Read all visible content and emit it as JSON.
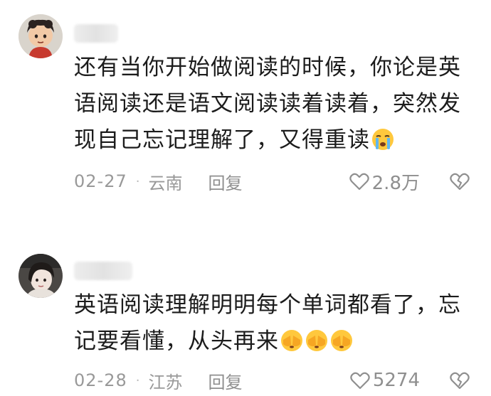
{
  "comments": [
    {
      "avatar_icon": "cartoon-character-avatar",
      "text": "还有当你开始做阅读的时候，你论是英语阅读还是语文阅读读着读着，突然发现自己忘记理解了，又得重读",
      "emojis": [
        "crying-face-emoji"
      ],
      "date": "02-27",
      "location": "云南",
      "reply_label": "回复",
      "like_count": "2.8万"
    },
    {
      "avatar_icon": "girl-photo-avatar",
      "text": "英语阅读理解明明每个单词都看了，忘记要看懂，从头再来",
      "emojis": [
        "face-palm-emoji",
        "face-palm-emoji",
        "face-palm-emoji"
      ],
      "date": "02-28",
      "location": "江苏",
      "reply_label": "回复",
      "like_count": "5274"
    }
  ],
  "meta_separator": "·",
  "colors": {
    "text": "#1c1c1c",
    "meta": "#999999",
    "emoji_yellow": "#ffc83d"
  }
}
